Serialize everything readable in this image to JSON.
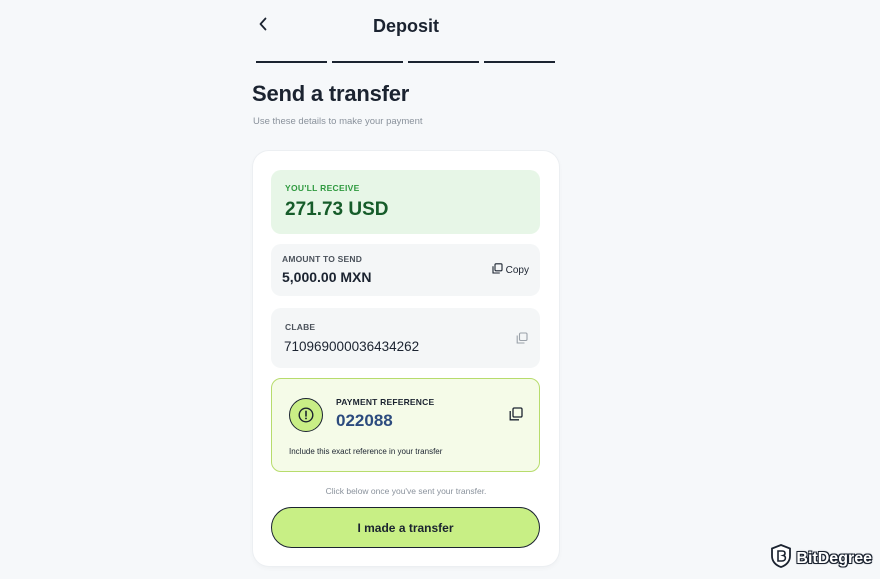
{
  "header": {
    "title": "Deposit",
    "back_icon": "chevron-left-icon",
    "steps_total": 4,
    "steps_completed": 4
  },
  "main": {
    "title": "Send a transfer",
    "subtitle": "Use these details to make your payment"
  },
  "receive": {
    "label": "YOU'LL RECEIVE",
    "value": "271.73 USD"
  },
  "amount_to_send": {
    "label": "AMOUNT TO SEND",
    "value": "5,000.00 MXN",
    "copy_label": "Copy"
  },
  "clabe": {
    "label": "CLABE",
    "value": "710969000036434262"
  },
  "payment_reference": {
    "label": "PAYMENT REFERENCE",
    "value": "022088",
    "note": "Include this exact reference in your transfer",
    "icon": "alert-circle-icon"
  },
  "footer": {
    "hint": "Click below once you've sent your transfer.",
    "cta_label": "I made a transfer"
  },
  "watermark": {
    "text": "BitDegree"
  },
  "colors": {
    "accent_green": "#c8ef85",
    "receive_bg": "#e7f6e7",
    "receive_text": "#165c2a",
    "reference_value": "#2c4b7e",
    "reference_border": "#b7dc6c"
  }
}
